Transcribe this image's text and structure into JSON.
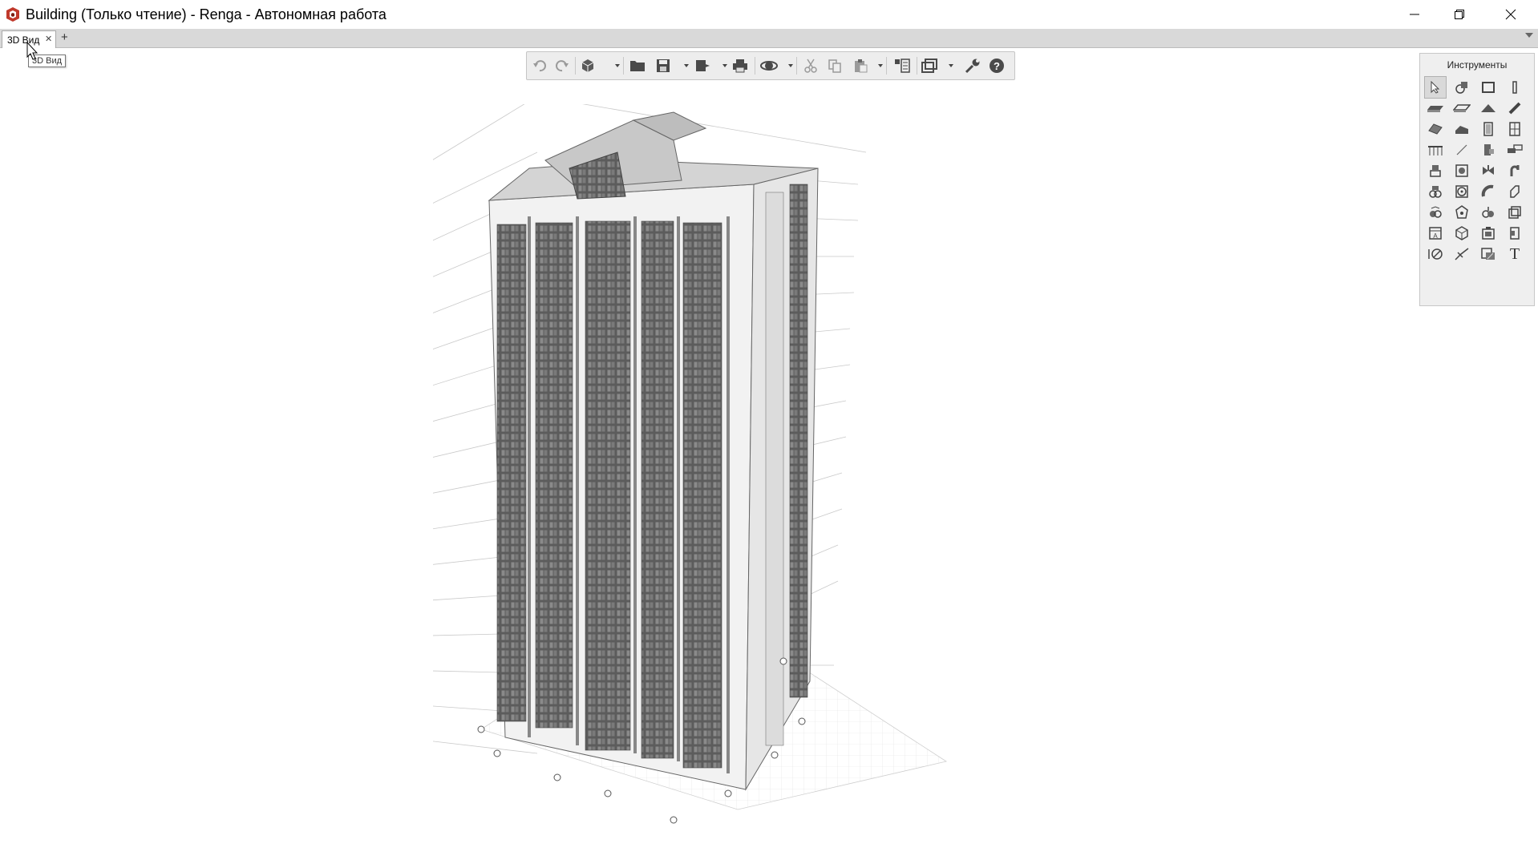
{
  "window": {
    "title": "Building (Только чтение) - Renga - Автономная работа",
    "controls": [
      "minimize",
      "restore",
      "close"
    ]
  },
  "tabs": [
    {
      "label": "3D Вид",
      "active": true
    }
  ],
  "tab_add_label": "+",
  "tooltip": "3D Вид",
  "toolbar": {
    "buttons": [
      "undo-icon",
      "redo-icon",
      "view-cube-icon",
      "open-folder-icon",
      "save-icon",
      "export-icon",
      "print-icon",
      "orbit-icon",
      "cut-icon",
      "copy-icon",
      "paste-icon",
      "properties-icon",
      "views-icon",
      "settings-wrench-icon",
      "help-icon"
    ]
  },
  "tools_panel": {
    "title": "Инструменты",
    "tools": [
      "select",
      "model-element",
      "wall-panel",
      "column",
      "wall",
      "floor",
      "roof",
      "beam",
      "slab",
      "stair",
      "door",
      "window",
      "railing",
      "line",
      "equipment",
      "pipe-fitting",
      "plumbing",
      "boiler",
      "valve",
      "pipe",
      "accessory",
      "fan",
      "elbow",
      "duct",
      "cable",
      "light",
      "switch",
      "panel",
      "room",
      "3d-model",
      "assembly",
      "opening",
      "dimension",
      "level-mark",
      "hatch",
      "text"
    ],
    "text_tool_label": "T"
  },
  "colors": {
    "toolbar_bg": "#ededed",
    "panel_bg": "#efefef",
    "tabbar_bg": "#d9d9d9",
    "accent_logo": "#c0392b"
  }
}
